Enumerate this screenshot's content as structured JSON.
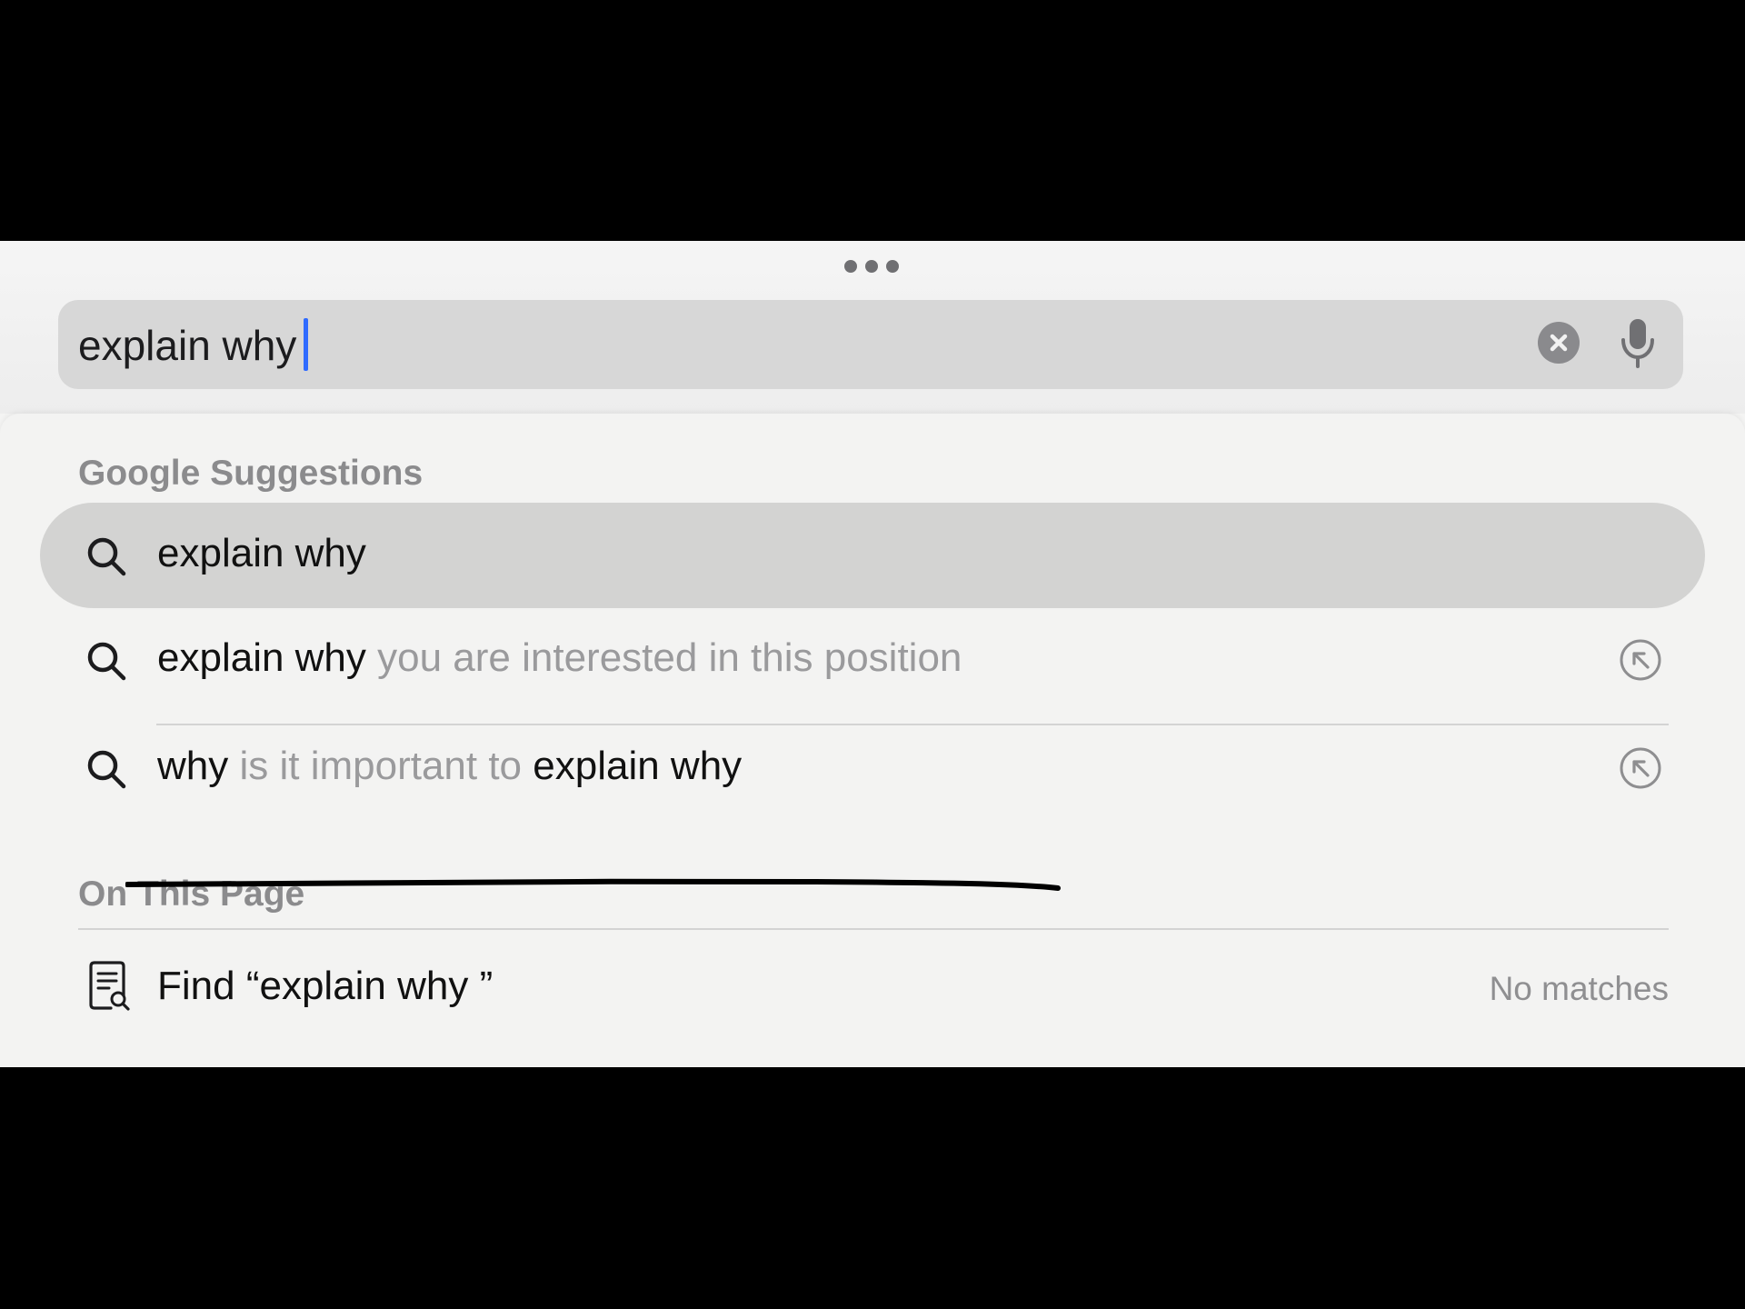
{
  "search": {
    "query": "explain why",
    "clear_icon": "xmark-circle-icon",
    "mic_icon": "microphone-icon"
  },
  "suggestions": {
    "heading": "Google Suggestions",
    "items": [
      {
        "parts": [
          {
            "text": "explain why",
            "muted": false
          }
        ],
        "highlighted": true
      },
      {
        "parts": [
          {
            "text": "explain why",
            "muted": false
          },
          {
            "text": " you are interested in this position",
            "muted": true
          }
        ],
        "highlighted": false,
        "struck_out": true
      },
      {
        "parts": [
          {
            "text": "why",
            "muted": false
          },
          {
            "text": " is it important to ",
            "muted": true
          },
          {
            "text": "explain why",
            "muted": false
          }
        ],
        "highlighted": false
      }
    ]
  },
  "on_this_page": {
    "heading": "On This Page",
    "find_label": "Find “explain why ”",
    "status": "No matches"
  },
  "colors": {
    "caret": "#2f6bff",
    "annotation_stroke": "#000000"
  }
}
